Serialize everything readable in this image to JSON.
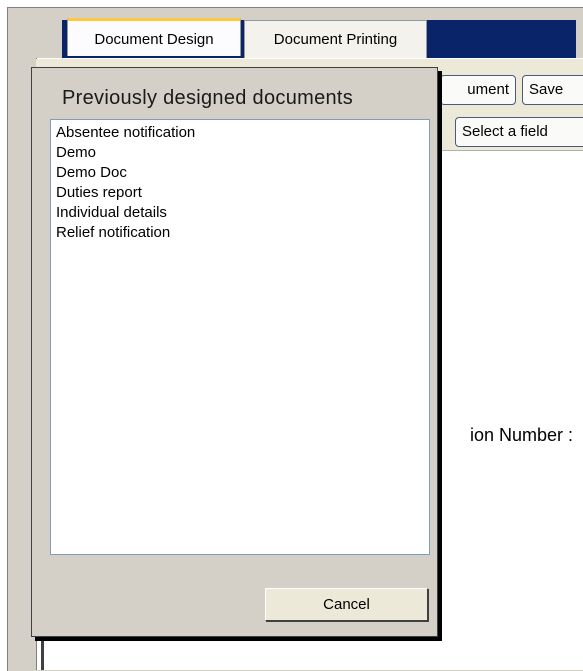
{
  "tabs": [
    {
      "label": "Document Design",
      "active": true
    },
    {
      "label": "Document Printing",
      "active": false
    }
  ],
  "toolbar": {
    "document_button_label": "ument",
    "save_button_label": "Save",
    "select_field_button_label": "Select a field"
  },
  "document": {
    "visible_text": "ion Number :"
  },
  "dialog": {
    "title": "Previously designed documents",
    "documents": [
      "Absentee notification",
      "Demo",
      "Demo Doc",
      "Duties report",
      "Individual details",
      "Relief notification"
    ],
    "cancel_label": "Cancel"
  },
  "colors": {
    "title_bar": "#0a246a",
    "active_tab_accent": "#ffc83c",
    "dialog_bg": "#d4d0c8",
    "list_border": "#7f9db9"
  }
}
